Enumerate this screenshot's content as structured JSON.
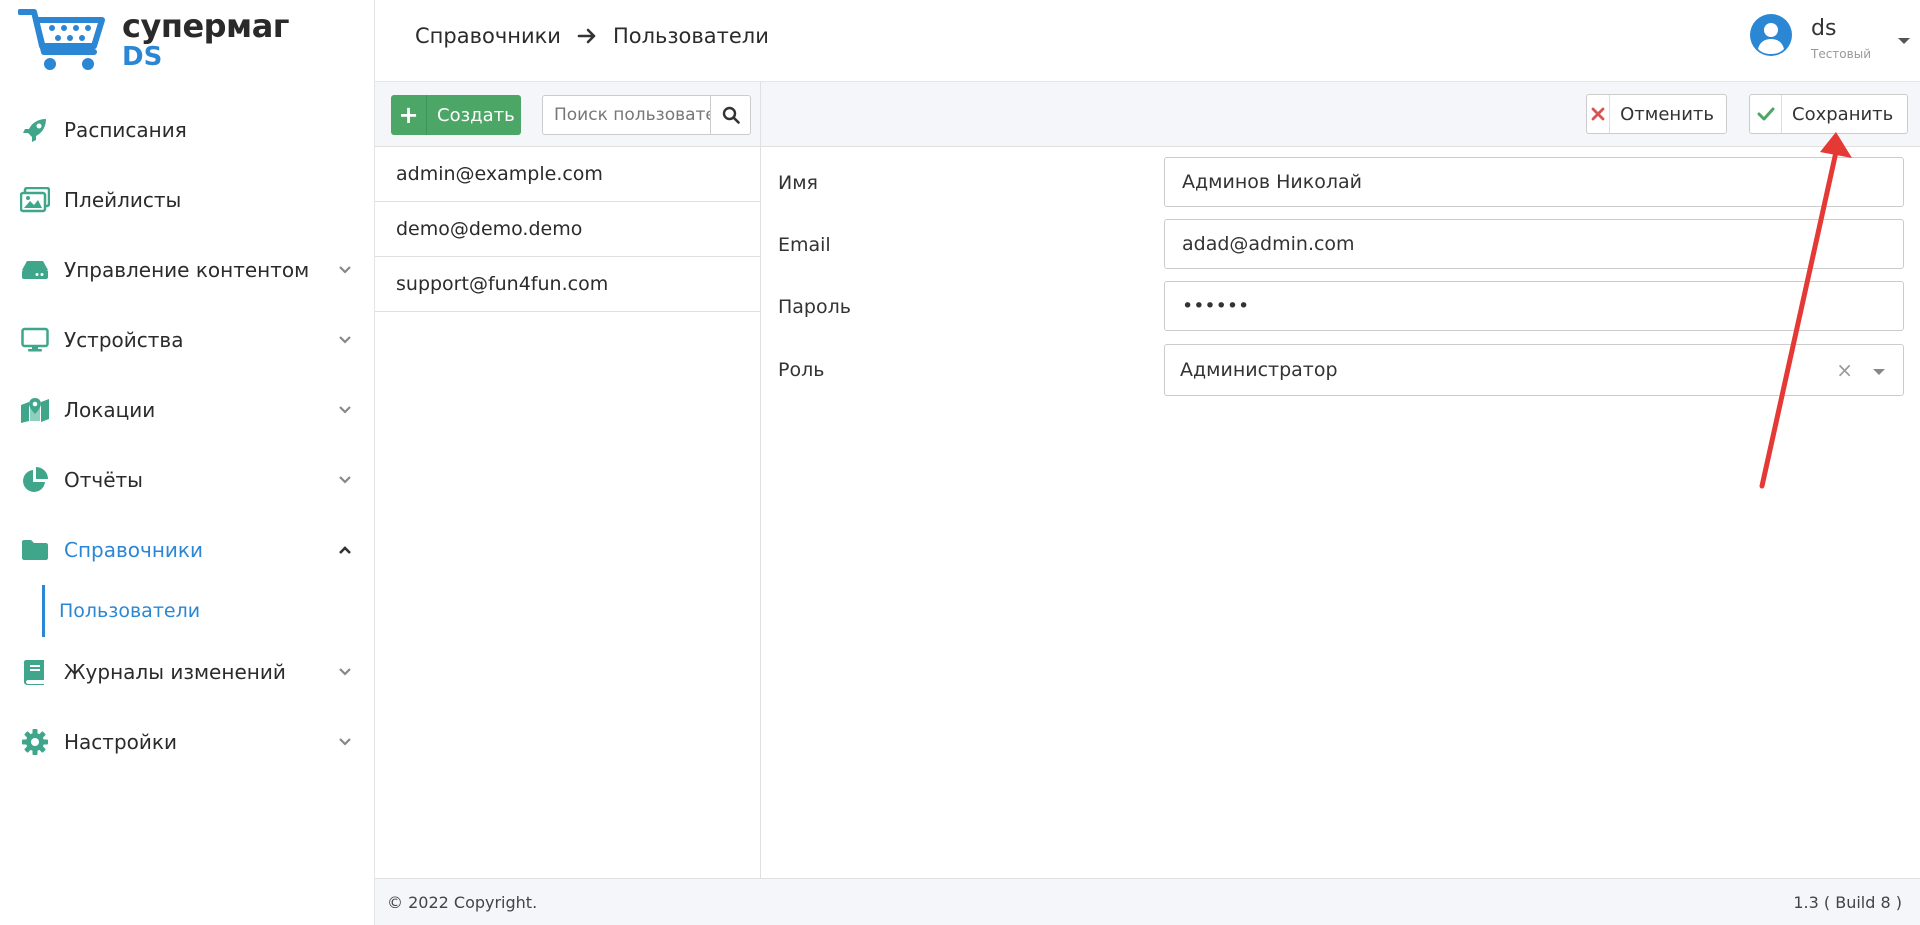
{
  "app": {
    "logo_line1": "супермаг",
    "logo_line2": "DS"
  },
  "sidebar": {
    "items": [
      {
        "label": "Расписания",
        "icon": "rocket-icon",
        "expandable": false
      },
      {
        "label": "Плейлисты",
        "icon": "images-icon",
        "expandable": false
      },
      {
        "label": "Управление контентом",
        "icon": "hdd-icon",
        "expandable": true
      },
      {
        "label": "Устройства",
        "icon": "monitor-icon",
        "expandable": true
      },
      {
        "label": "Локации",
        "icon": "map-marker-icon",
        "expandable": true
      },
      {
        "label": "Отчёты",
        "icon": "pie-chart-icon",
        "expandable": true
      },
      {
        "label": "Справочники",
        "icon": "folder-icon",
        "expandable": true,
        "expanded": true,
        "active": true
      },
      {
        "label": "Журналы изменений",
        "icon": "book-icon",
        "expandable": true
      },
      {
        "label": "Настройки",
        "icon": "gear-icon",
        "expandable": true
      }
    ],
    "sub_items": [
      {
        "label": "Пользователи",
        "active": true
      }
    ]
  },
  "header": {
    "breadcrumb": [
      "Справочники",
      "Пользователи"
    ],
    "user": {
      "name": "ds",
      "role": "Тестовый"
    }
  },
  "list": {
    "create_label": "Создать",
    "search_placeholder": "Поиск пользователя",
    "users": [
      "admin@example.com",
      "demo@demo.demo",
      "support@fun4fun.com"
    ]
  },
  "form": {
    "cancel_label": "Отменить",
    "save_label": "Сохранить",
    "fields": [
      {
        "label": "Имя",
        "value": "Админов Николай",
        "type": "text"
      },
      {
        "label": "Email",
        "value": "adad@admin.com",
        "type": "text"
      },
      {
        "label": "Пароль",
        "value": "••••••",
        "type": "password"
      },
      {
        "label": "Роль",
        "value": "Администратор",
        "type": "select"
      }
    ]
  },
  "footer": {
    "copyright": "© 2022 Copyright.",
    "build": "1.3 ( Build 8 )"
  },
  "colors": {
    "accent": "#2b86d4",
    "icon": "#3fa68c",
    "create": "#4ca766",
    "cancel_icon": "#d9534f",
    "save_icon": "#4ca766",
    "annotation": "#e53935"
  }
}
